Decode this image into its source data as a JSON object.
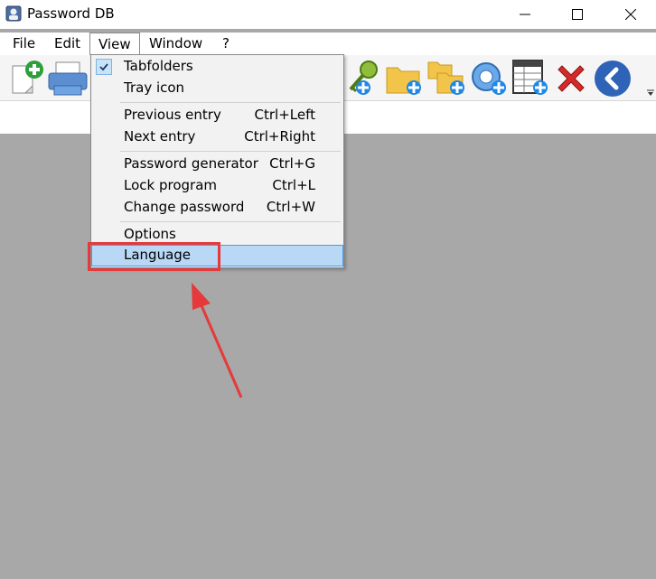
{
  "window": {
    "title": "Password DB"
  },
  "menubar": {
    "items": [
      "File",
      "Edit",
      "View",
      "Window",
      "?"
    ]
  },
  "view_menu": {
    "items": [
      {
        "label": "Tabfolders",
        "shortcut": "",
        "checked": true
      },
      {
        "label": "Tray icon",
        "shortcut": ""
      },
      {
        "label": "Previous entry",
        "shortcut": "Ctrl+Left"
      },
      {
        "label": "Next entry",
        "shortcut": "Ctrl+Right"
      },
      {
        "label": "Password generator",
        "shortcut": "Ctrl+G"
      },
      {
        "label": "Lock program",
        "shortcut": "Ctrl+L"
      },
      {
        "label": "Change password",
        "shortcut": "Ctrl+W"
      },
      {
        "label": "Options",
        "shortcut": ""
      },
      {
        "label": "Language",
        "shortcut": "",
        "highlighted": true
      }
    ]
  },
  "toolbar": {
    "icons": [
      "new-entry-icon",
      "print-icon",
      "add-key-icon",
      "add-folder-icon",
      "add-subfolder-icon",
      "add-globe-icon",
      "add-table-icon",
      "delete-icon",
      "back-icon"
    ]
  },
  "colors": {
    "highlight": "#b8d8f6",
    "annotation": "#e5393a",
    "background": "#a8a8a8"
  }
}
